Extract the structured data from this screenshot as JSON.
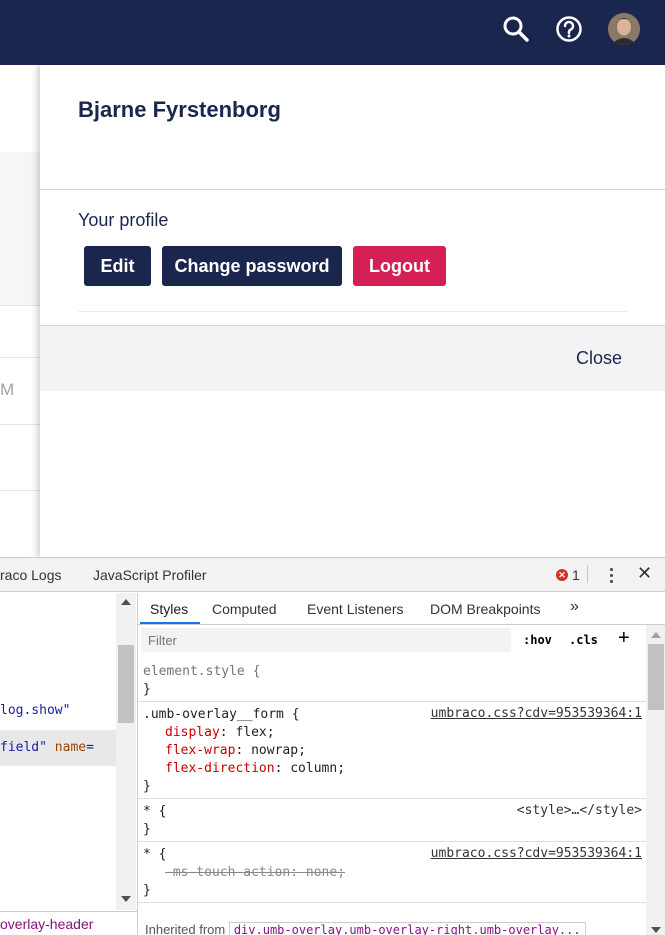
{
  "colors": {
    "nav": "#1b264f",
    "primary_button": "#1b264f",
    "logout_button": "#d42054",
    "tab_active": "#1a73e8"
  },
  "topbar": {
    "icons": [
      "search-icon",
      "help-icon",
      "user-avatar"
    ]
  },
  "background": {
    "partial_text": "M"
  },
  "profile_overlay": {
    "user_name": "Bjarne Fyrstenborg",
    "section_title": "Your profile",
    "buttons": {
      "edit": "Edit",
      "change_password": "Change password",
      "logout": "Logout"
    },
    "close": "Close"
  },
  "devtools": {
    "tabs": [
      "raco Logs",
      "JavaScript Profiler"
    ],
    "error_count": "1",
    "elements": {
      "line1_value": "log.show",
      "line2_value": "field",
      "line2_attr": "name",
      "breadcrumb": "overlay-header"
    },
    "styles": {
      "tabs": [
        "Styles",
        "Computed",
        "Event Listeners",
        "DOM Breakpoints"
      ],
      "more": "»",
      "filter_placeholder": "Filter",
      "hov": ":hov",
      "cls": ".cls",
      "plus": "+",
      "rules": [
        {
          "selector": "element.style {",
          "source": "",
          "declarations": []
        },
        {
          "selector": ".umb-overlay__form {",
          "source": "umbraco.css?cdv=953539364:1",
          "declarations": [
            {
              "prop": "display",
              "value": "flex;"
            },
            {
              "prop": "flex-wrap",
              "value": "nowrap;"
            },
            {
              "prop": "flex-direction",
              "value": "column;"
            }
          ]
        },
        {
          "selector": "* {",
          "source": "<style>…</style>",
          "declarations": []
        },
        {
          "selector": "* {",
          "source": "umbraco.css?cdv=953539364:1",
          "declarations": [
            {
              "prop": "-ms-touch-action",
              "value": "none;",
              "struck": true
            }
          ]
        }
      ],
      "inherited_label": "Inherited from",
      "inherited_node": "div.umb-overlay.umb-overlay-right.umb-overlay..."
    }
  }
}
